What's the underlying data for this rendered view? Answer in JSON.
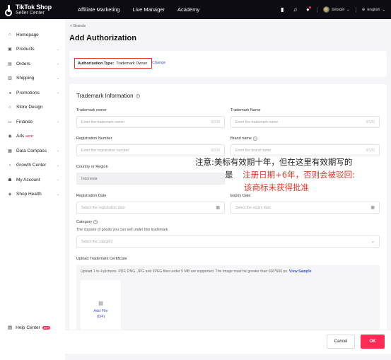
{
  "topbar": {
    "logo_line1": "TikTok Shop",
    "logo_line2": "Seller Center",
    "nav": [
      "Affiliate Marketing",
      "Live Manager",
      "Academy"
    ],
    "account_name": "bebidel",
    "language": "English"
  },
  "sidebar": {
    "items": [
      {
        "label": "Homepage",
        "icon": "home-icon",
        "chevron": false
      },
      {
        "label": "Products",
        "icon": "box-icon",
        "chevron": true
      },
      {
        "label": "Orders",
        "icon": "orders-icon",
        "chevron": true
      },
      {
        "label": "Shipping",
        "icon": "truck-icon",
        "chevron": true
      },
      {
        "label": "Promotions",
        "icon": "megaphone-icon",
        "chevron": true
      },
      {
        "label": "Store Design",
        "icon": "store-icon",
        "chevron": false
      },
      {
        "label": "Finance",
        "icon": "wallet-icon",
        "chevron": true
      },
      {
        "label": "Ads",
        "icon": "ads-icon",
        "chevron": false,
        "hot": "HOT!"
      },
      {
        "label": "Data Compass",
        "icon": "chart-icon",
        "chevron": true
      },
      {
        "label": "Growth Center",
        "icon": "growth-icon",
        "chevron": true
      },
      {
        "label": "My Account",
        "icon": "account-icon",
        "chevron": true
      },
      {
        "label": "Shop Health",
        "icon": "shield-icon",
        "chevron": true
      }
    ],
    "help_label": "Help Center",
    "help_badge": "99+"
  },
  "breadcrumb": "< Brands",
  "page_title": "Add Authorization",
  "auth": {
    "type_label": "Authorization Type:",
    "type_value": "Trademark Owner",
    "change_label": "Change"
  },
  "trademark": {
    "section_title": "Trademark Information",
    "owner_label": "Trademark owner",
    "owner_placeholder": "Enter the trademark owner",
    "owner_count": "0/100",
    "name_label": "Trademark Name",
    "name_placeholder": "Enter the trademark name",
    "name_count": "0/100",
    "regnum_label": "Registration Number",
    "regnum_placeholder": "Enter the registration number",
    "regnum_count": "0/100",
    "brand_label": "Brand name",
    "brand_placeholder": "Enter the brand name",
    "brand_count": "0/100",
    "country_label": "Country or Region",
    "country_value": "Indonesia",
    "regdate_label": "Registration Date",
    "regdate_placeholder": "Select the registration date",
    "expiry_label": "Expiry Date",
    "expiry_placeholder": "Select the expiry date",
    "category_label": "Category",
    "category_desc": "The classes of goods you can sell under this trademark",
    "category_placeholder": "Select the category",
    "upload_label": "Upload Trademark Certificate",
    "upload_hint": "Upload 1 to 4 pictures. PDF, PNG, JPG and JPEG files under 5 MB are supported. The image must be greater than 600*600 px.",
    "upload_link": "View Sample",
    "add_file_label": "Add File",
    "add_file_count": "(0/4)"
  },
  "annotation": {
    "lead": "注意:",
    "line1": "美标有效期十年，但在这里有效期写的",
    "line2_lead": "是",
    "line2": "注册日期+6年，否则会被驳回:",
    "line3": "该商标未获得批准"
  },
  "footer": {
    "cancel_label": "Cancel",
    "ok_label": "OK"
  },
  "colors": {
    "accent": "#fe2c55",
    "link": "#3b57d9",
    "annotation": "#e23a2b",
    "topbar_bg": "#0c0c12"
  }
}
